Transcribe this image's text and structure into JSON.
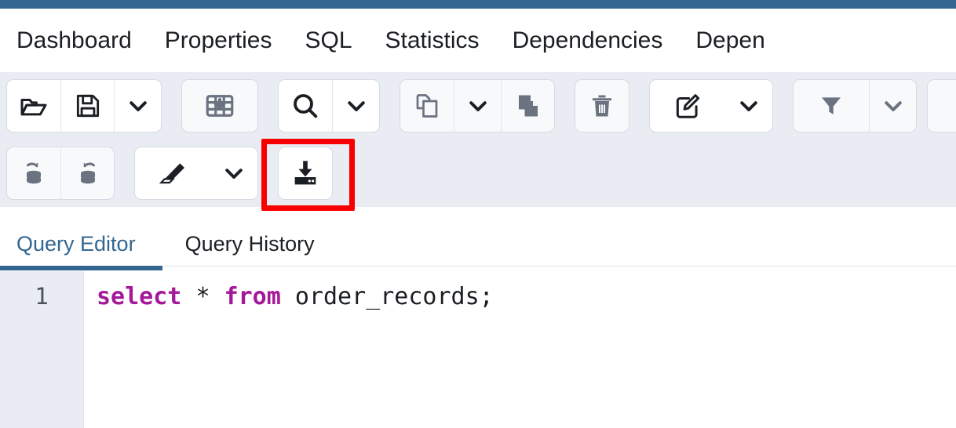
{
  "theme": {
    "brand_blue": "#336791",
    "toolbar_bg": "#e9ecf2",
    "button_bg": "#ffffff",
    "button_disabled_bg": "#f7f9fb",
    "border": "#d6dbe3",
    "icon_dark": "#1b1f23",
    "icon_gray": "#6b7280",
    "annotation_red": "#f90000",
    "keyword_purple": "#a4189a"
  },
  "object_tabs": [
    {
      "label": "Dashboard",
      "active": false
    },
    {
      "label": "Properties",
      "active": false
    },
    {
      "label": "SQL",
      "active": false
    },
    {
      "label": "Statistics",
      "active": false
    },
    {
      "label": "Dependencies",
      "active": false
    },
    {
      "label": "Depen",
      "active": false
    }
  ],
  "toolbar_row_1": {
    "groups": [
      {
        "enabled": true,
        "buttons": [
          {
            "icon": "open-file-icon",
            "label": "Open File",
            "enabled": true
          },
          {
            "icon": "save-file-icon",
            "label": "Save File",
            "enabled": true
          },
          {
            "icon": "chevron-down-icon",
            "label": "Save options",
            "enabled": true
          }
        ]
      },
      {
        "enabled": false,
        "buttons": [
          {
            "icon": "table-download-icon",
            "label": "Download as CSV",
            "enabled": false
          }
        ]
      },
      {
        "enabled": true,
        "buttons": [
          {
            "icon": "search-icon",
            "label": "Find",
            "enabled": true
          },
          {
            "icon": "chevron-down-icon",
            "label": "Find options",
            "enabled": true
          }
        ]
      },
      {
        "enabled": false,
        "buttons": [
          {
            "icon": "copy-icon",
            "label": "Copy",
            "enabled": false
          },
          {
            "icon": "chevron-down-icon",
            "label": "Copy options",
            "enabled": false
          },
          {
            "icon": "paste-icon",
            "label": "Paste",
            "enabled": false
          }
        ]
      },
      {
        "enabled": false,
        "buttons": [
          {
            "icon": "trash-icon",
            "label": "Delete",
            "enabled": false
          }
        ]
      },
      {
        "enabled": true,
        "buttons": [
          {
            "icon": "edit-pencil-icon",
            "label": "Edit",
            "enabled": true
          },
          {
            "icon": "chevron-down-icon",
            "label": "Edit options",
            "enabled": true
          }
        ]
      },
      {
        "enabled": false,
        "buttons": [
          {
            "icon": "filter-icon",
            "label": "Filter",
            "enabled": false
          },
          {
            "icon": "chevron-down-icon",
            "label": "Filter options",
            "enabled": false
          }
        ]
      },
      {
        "enabled": false,
        "buttons": [
          {
            "icon": "partial-icon",
            "label": "More",
            "enabled": false
          }
        ]
      }
    ]
  },
  "toolbar_row_2": {
    "groups": [
      {
        "enabled": false,
        "buttons": [
          {
            "icon": "commit-icon",
            "label": "Commit",
            "enabled": false
          },
          {
            "icon": "rollback-icon",
            "label": "Rollback",
            "enabled": false
          }
        ]
      },
      {
        "enabled": true,
        "buttons": [
          {
            "icon": "eraser-icon",
            "label": "Clear",
            "enabled": true
          },
          {
            "icon": "chevron-down-icon",
            "label": "Clear options",
            "enabled": true
          }
        ]
      },
      {
        "enabled": true,
        "highlighted": true,
        "buttons": [
          {
            "icon": "download-tray-icon",
            "label": "Download results",
            "enabled": true
          }
        ]
      }
    ]
  },
  "annotation": {
    "target_icon": "download-tray-icon",
    "target_label": "Download results"
  },
  "query_tabs": [
    {
      "label": "Query Editor",
      "active": true
    },
    {
      "label": "Query History",
      "active": false
    }
  ],
  "editor": {
    "line_numbers": [
      "1"
    ],
    "sql_tokens": [
      {
        "text": "select",
        "type": "keyword"
      },
      {
        "text": " ",
        "type": "plain"
      },
      {
        "text": "*",
        "type": "operator"
      },
      {
        "text": " ",
        "type": "plain"
      },
      {
        "text": "from",
        "type": "keyword"
      },
      {
        "text": " ",
        "type": "plain"
      },
      {
        "text": "order_records;",
        "type": "identifier"
      }
    ],
    "sql_text": "select * from order_records;"
  }
}
